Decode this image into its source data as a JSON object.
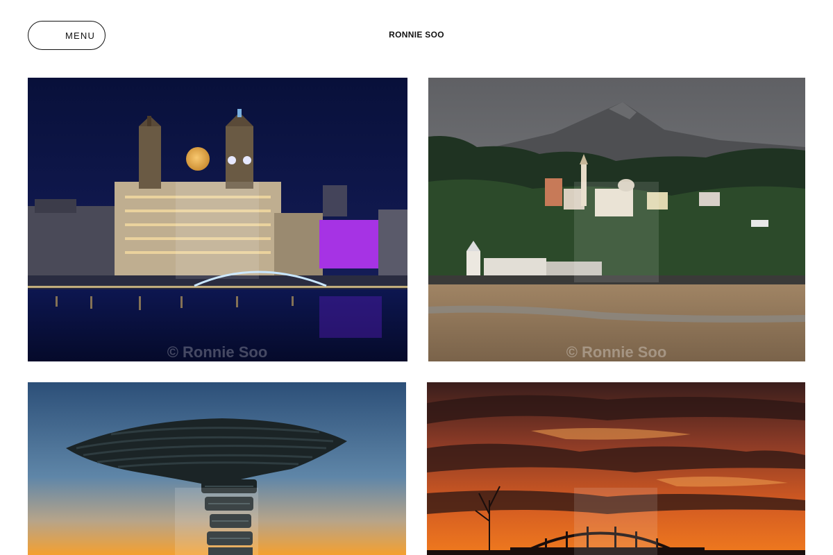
{
  "header": {
    "menu_label": "MENU",
    "site_title": "RONNIE SOO"
  },
  "gallery": {
    "watermark": "© Ronnie Soo"
  },
  "colors": {
    "text": "#111111",
    "background": "#ffffff"
  }
}
